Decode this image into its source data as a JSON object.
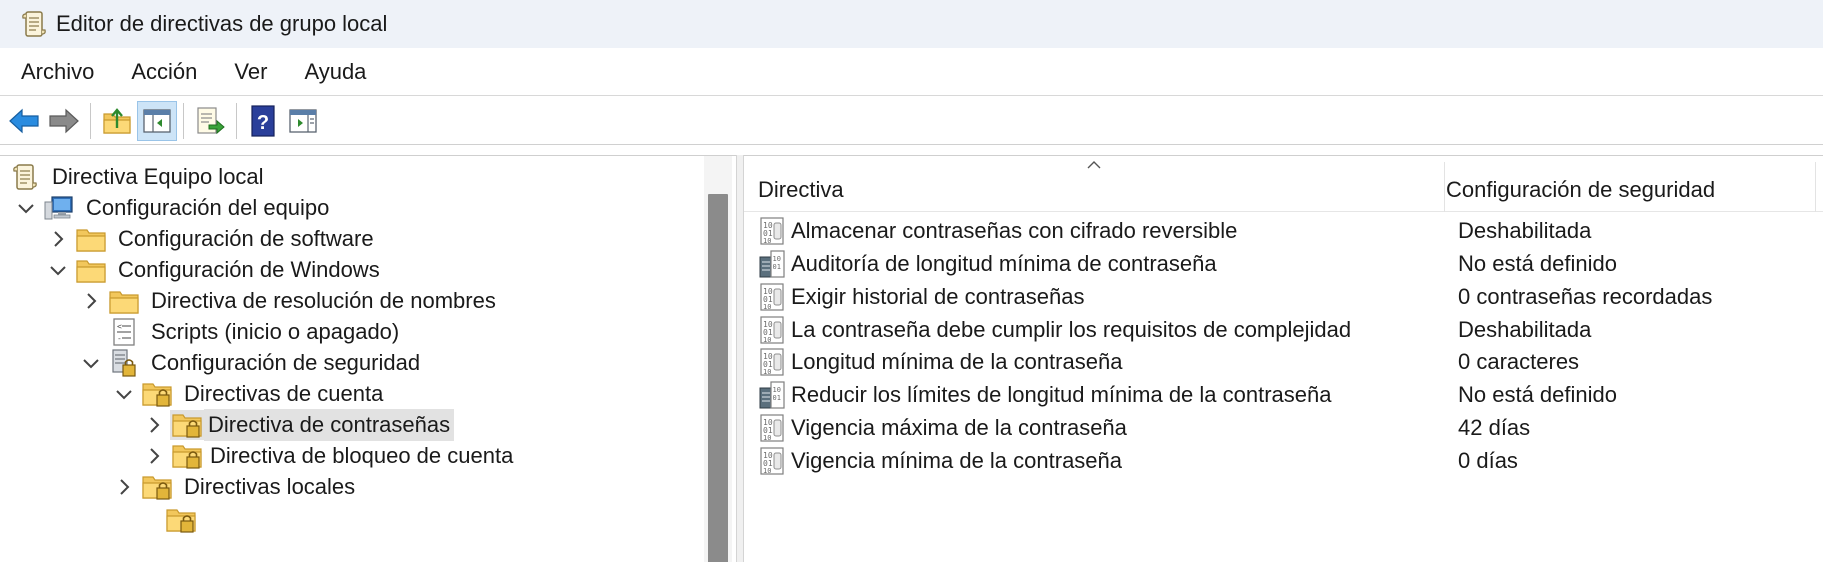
{
  "window": {
    "title": "Editor de directivas de grupo local",
    "app_icon": "scroll-icon"
  },
  "menu": [
    "Archivo",
    "Acción",
    "Ver",
    "Ayuda"
  ],
  "toolbar": {
    "buttons": [
      "back-arrow-icon",
      "forward-arrow-icon",
      "up-folder-icon",
      "show-hide-tree-icon",
      "export-list-icon",
      "help-icon",
      "show-hide-action-pane-icon"
    ],
    "active": "show-hide-tree-icon"
  },
  "tree": {
    "items": [
      {
        "label": "Directiva Equipo local",
        "icon": "scroll-icon",
        "expander": "none"
      },
      {
        "label": "Configuración del equipo",
        "icon": "computer-icon",
        "expander": "expanded"
      },
      {
        "label": "Configuración de software",
        "icon": "folder-icon",
        "expander": "collapsed"
      },
      {
        "label": "Configuración de Windows",
        "icon": "folder-icon",
        "expander": "expanded"
      },
      {
        "label": "Directiva de resolución de nombres",
        "icon": "folder-icon",
        "expander": "collapsed"
      },
      {
        "label": "Scripts (inicio o apagado)",
        "icon": "script-icon",
        "expander": "none"
      },
      {
        "label": "Configuración de seguridad",
        "icon": "security-server-icon",
        "expander": "expanded"
      },
      {
        "label": "Directivas de cuenta",
        "icon": "locked-folder-icon",
        "expander": "expanded"
      },
      {
        "label": "Directiva de contraseñas",
        "icon": "locked-folder-icon",
        "expander": "collapsed",
        "selected": true
      },
      {
        "label": "Directiva de bloqueo de cuenta",
        "icon": "locked-folder-icon",
        "expander": "collapsed"
      },
      {
        "label": "Directivas locales",
        "icon": "locked-folder-icon",
        "expander": "collapsed"
      }
    ]
  },
  "list": {
    "columns": [
      "Directiva",
      "Configuración de seguridad"
    ],
    "sort_column": "Directiva",
    "rows": [
      {
        "name": "Almacenar contraseñas con cifrado reversible",
        "value": "Deshabilitada",
        "icon": "policy-binary-icon"
      },
      {
        "name": "Auditoría de longitud mínima de contraseña",
        "value": "No está definido",
        "icon": "policy-server-icon"
      },
      {
        "name": "Exigir historial de contraseñas",
        "value": "0 contraseñas recordadas",
        "icon": "policy-binary-icon"
      },
      {
        "name": "La contraseña debe cumplir los requisitos de complejidad",
        "value": "Deshabilitada",
        "icon": "policy-binary-icon"
      },
      {
        "name": "Longitud mínima de la contraseña",
        "value": "0 caracteres",
        "icon": "policy-binary-icon"
      },
      {
        "name": "Reducir los límites de longitud mínima de la contraseña",
        "value": "No está definido",
        "icon": "policy-server-icon"
      },
      {
        "name": "Vigencia máxima de la contraseña",
        "value": "42 días",
        "icon": "policy-binary-icon"
      },
      {
        "name": "Vigencia mínima de la contraseña",
        "value": "0 días",
        "icon": "policy-binary-icon"
      }
    ]
  },
  "colors": {
    "titlebar_bg": "#eef2f8",
    "selected_bg": "#e2e2e2",
    "toolbar_active_bg": "#cde4f7",
    "scroll_thumb": "#8b8b8b"
  }
}
